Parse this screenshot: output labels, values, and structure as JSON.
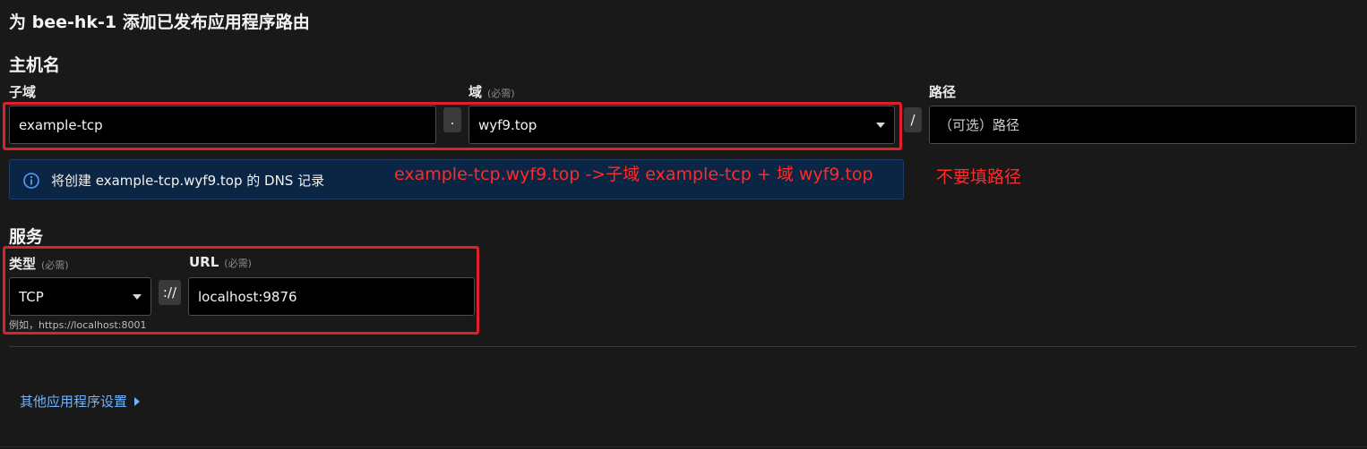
{
  "page": {
    "title": "为 bee-hk-1 添加已发布应用程序路由"
  },
  "hostname": {
    "section_title": "主机名",
    "subdomain": {
      "label": "子域",
      "value": "example-tcp"
    },
    "dot_separator": ".",
    "domain": {
      "label": "域",
      "required": "(必需)",
      "value": "wyf9.top"
    },
    "slash_separator": "/",
    "path": {
      "label": "路径",
      "placeholder": "（可选）路径"
    },
    "info": {
      "icon": "info-icon",
      "text": "将创建 example-tcp.wyf9.top 的 DNS 记录"
    }
  },
  "service": {
    "section_title": "服务",
    "type": {
      "label": "类型",
      "required": "(必需)",
      "value": "TCP",
      "hint": "例如，https://localhost:8001"
    },
    "scheme_separator": "://",
    "url": {
      "label": "URL",
      "required": "(必需)",
      "value": "localhost:9876"
    }
  },
  "other_settings": {
    "label": "其他应用程序设置",
    "icon": "caret-right-icon"
  },
  "annotations": {
    "domain_note": "example-tcp.wyf9.top ->子域 example-tcp + 域 wyf9.top",
    "path_note": "不要填路径"
  },
  "colors": {
    "background": "#191919",
    "annotation": "#e0202a",
    "link": "#6fb4ff",
    "info_bg": "#0b2545"
  }
}
